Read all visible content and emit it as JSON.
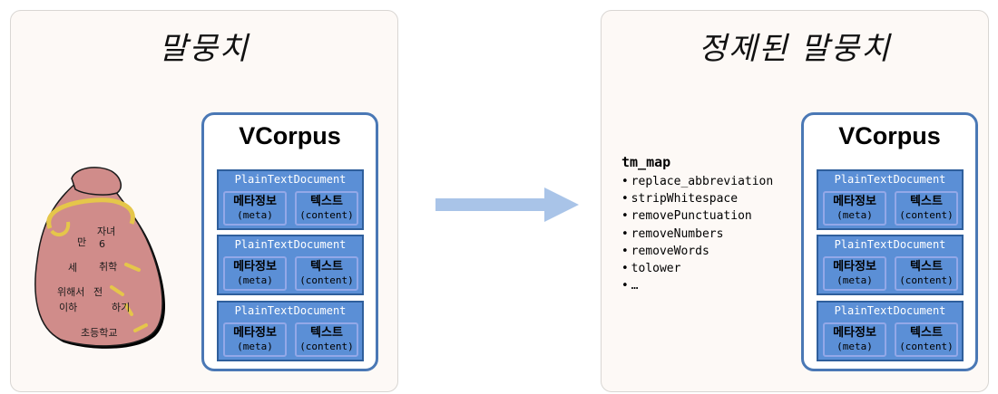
{
  "left_panel": {
    "title": "말뭉치",
    "bag_words": [
      "만",
      "자녀",
      "6",
      "세",
      "취학",
      "위해서",
      "전",
      "이하",
      "하기",
      "초등학교"
    ]
  },
  "right_panel": {
    "title": "정제된 말뭉치",
    "ops_title": "tm_map",
    "ops": [
      "replace_abbreviation",
      "stripWhitespace",
      "removePunctuation",
      "removeNumbers",
      "removeWords",
      "tolower",
      "…"
    ]
  },
  "corpus": {
    "title": "VCorpus",
    "doc_title": "PlainTextDocument",
    "meta_label": "메타정보",
    "meta_sub": "(meta)",
    "content_label": "텍스트",
    "content_sub": "(content)"
  },
  "colors": {
    "doc_fill": "#5b8fd6",
    "corpus_border": "#4a78b5",
    "bag_fill": "#d08c8a",
    "bag_string": "#e5c64a",
    "arrow": "#a9c4e8"
  }
}
